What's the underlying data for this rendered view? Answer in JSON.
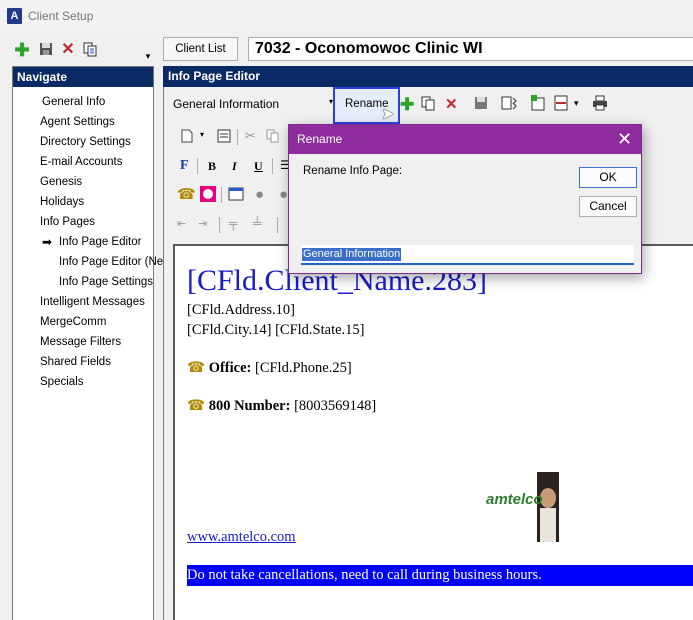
{
  "window": {
    "title": "Client Setup",
    "icon": "app-icon"
  },
  "left_toolbar": {
    "icons": [
      "add-icon",
      "save-icon",
      "delete-icon",
      "copy-icon",
      "dropdown-icon"
    ]
  },
  "navigate": {
    "header": "Navigate",
    "items": [
      "General Info",
      "Agent Settings",
      "Directory Settings",
      "E-mail Accounts",
      "Genesis",
      "Holidays",
      "Info Pages",
      "Info Page Editor",
      "Info Page Editor (Ne",
      "Info Page Settings",
      "Intelligent Messages",
      "MergeComm",
      "Message Filters",
      "Shared Fields",
      "Specials"
    ],
    "selected": "Info Page Editor"
  },
  "header": {
    "client_list_label": "Client List",
    "client_name": "7032  -  Oconomowoc Clinic WI"
  },
  "editor": {
    "header": "Info Page Editor",
    "page_select": "General Information",
    "rename_label": "Rename",
    "format_labels": {
      "bold": "B",
      "italic": "I",
      "underline": "U",
      "font": "F"
    }
  },
  "document": {
    "title": "[CFld.Client_Name.283]",
    "address": "[CFld.Address.10]",
    "city_state": "[CFld.City.14] [CFld.State.15]",
    "office_label": "Office:",
    "office_value": "[CFld.Phone.25]",
    "toll_label": "800 Number:",
    "toll_value": "[8003569148]",
    "logo_text": "amtelco",
    "link": "www.amtelco.com",
    "banner": "Do not take cancellations, need to call during business hours.",
    "phone_icon": "☎"
  },
  "dialog": {
    "title": "Rename",
    "prompt": "Rename Info Page:",
    "ok": "OK",
    "cancel": "Cancel",
    "input_value": "General Information"
  },
  "colors": {
    "nav_header": "#0a2a66",
    "dialog_title": "#8e2c9e",
    "link": "#1a1acc",
    "banner": "#0000ff"
  }
}
